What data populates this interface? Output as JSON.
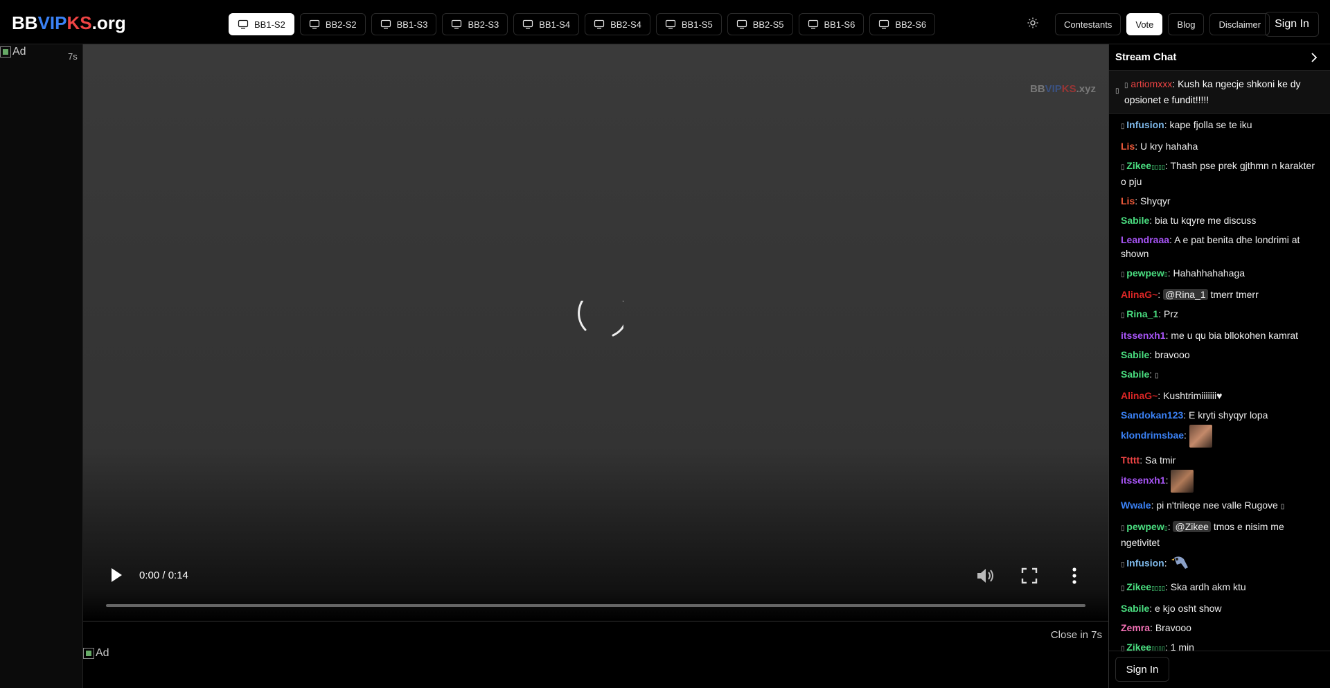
{
  "header": {
    "logo": {
      "part1": "BB",
      "part2": "VIP",
      "part3": "KS",
      "part4": ".org"
    },
    "tabs": [
      {
        "label": "BB1-S2",
        "active": true
      },
      {
        "label": "BB2-S2"
      },
      {
        "label": "BB1-S3"
      },
      {
        "label": "BB2-S3"
      },
      {
        "label": "BB1-S4"
      },
      {
        "label": "BB2-S4"
      },
      {
        "label": "BB1-S5"
      },
      {
        "label": "BB2-S5"
      },
      {
        "label": "BB1-S6"
      },
      {
        "label": "BB2-S6"
      }
    ],
    "nav": {
      "contestants": "Contestants",
      "vote": "Vote",
      "blog": "Blog",
      "disclaimer": "Disclaimer"
    },
    "sign_in": "Sign In"
  },
  "left_ad": {
    "alt": "Ad",
    "timer": "7s"
  },
  "video": {
    "watermark": {
      "part1": "BB",
      "part2": "VIP",
      "part3": "KS",
      "part4": ".xyz"
    },
    "time": "0:00 / 0:14"
  },
  "below_ad": {
    "close_text": "Close in 7s",
    "alt": "Ad"
  },
  "chat": {
    "title": "Stream Chat",
    "pinned": {
      "user": "artiomxxx",
      "text": "Kush ka ngecje shkoni ke dy opsionet e fundit!!!!!"
    },
    "messages": [
      {
        "prefix": "",
        "user": "Infusion",
        "color": "#7db7e8",
        "text": "kape fjolla se te iku"
      },
      {
        "prefix": "",
        "user": "Lis",
        "color": "#ef5a3a",
        "text": "U kry hahaha"
      },
      {
        "prefix": "",
        "user": "Zikee",
        "color": "#4ade80",
        "text": "Thash pse prek gjthmn n karakter o pju"
      },
      {
        "prefix": "",
        "user": "Lis",
        "color": "#ef5a3a",
        "text": "Shyqyr"
      },
      {
        "prefix": "",
        "user": "Sabile",
        "color": "#4ade80",
        "text": "bia tu kqyre me discuss"
      },
      {
        "prefix": "",
        "user": "Leandraaa",
        "color": "#a855f7",
        "text": "A e pat benita dhe londrimi at shown"
      },
      {
        "prefix": "",
        "user": "pewpew",
        "color": "#4ade80",
        "text": "Hahahhahahaga"
      },
      {
        "prefix": "",
        "user": "AlinaG~",
        "color": "#dc2626",
        "mention": "@Rina_1",
        "text": "tmerr tmerr"
      },
      {
        "prefix": "",
        "user": "Rina_1",
        "color": "#4ade80",
        "text": "Prz"
      },
      {
        "prefix": "",
        "user": "itssenxh1",
        "color": "#a855f7",
        "text": "me u qu bia bllokohen kamrat"
      },
      {
        "prefix": "",
        "user": "Sabile",
        "color": "#4ade80",
        "text": "bravooo"
      },
      {
        "prefix": "",
        "user": "Sabile",
        "color": "#4ade80",
        "text": ""
      },
      {
        "prefix": "",
        "user": "AlinaG~",
        "color": "#dc2626",
        "text": "Kushtrimiiiiiii♥"
      },
      {
        "prefix": "",
        "user": "Sandokan123",
        "color": "#3b82f6",
        "text": "E kryti shyqyr lopa"
      },
      {
        "prefix": "",
        "user": "klondrimsbae",
        "color": "#3b82f6",
        "text": "",
        "image": "photo"
      },
      {
        "prefix": "",
        "user": "Ttttt",
        "color": "#ef4444",
        "text": "Sa tmir"
      },
      {
        "prefix": "",
        "user": "itssenxh1",
        "color": "#a855f7",
        "text": "",
        "image": "photo"
      },
      {
        "prefix": "",
        "user": "Wwale",
        "color": "#3b82f6",
        "text": "pi n'trileqe nee valle Rugove"
      },
      {
        "prefix": "",
        "user": "pewpew",
        "color": "#4ade80",
        "mention": "@Zikee",
        "text": "tmos e nisim me ngetivitet"
      },
      {
        "prefix": "",
        "user": "Infusion",
        "color": "#7db7e8",
        "text": "",
        "image": "bird"
      },
      {
        "prefix": "",
        "user": "Zikee",
        "color": "#4ade80",
        "text": "Ska ardh akm ktu"
      },
      {
        "prefix": "",
        "user": "Sabile",
        "color": "#4ade80",
        "text": "e kjo osht show"
      },
      {
        "prefix": "",
        "user": "Zemra",
        "color": "#f472b6",
        "text": "Bravooo"
      },
      {
        "prefix": "",
        "user": "Zikee",
        "color": "#4ade80",
        "text": "1 min"
      }
    ],
    "sign_in": "Sign In"
  }
}
